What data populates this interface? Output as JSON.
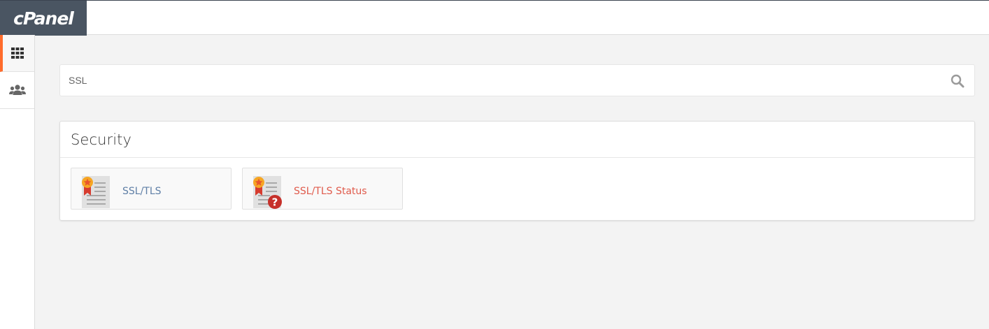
{
  "app": {
    "logo_text": "cPanel"
  },
  "sidebar": {
    "items": [
      {
        "name": "home-grid",
        "icon": "grid-icon",
        "active": true
      },
      {
        "name": "users",
        "icon": "users-icon",
        "active": false
      }
    ],
    "accent_color": "#ff6c2c"
  },
  "search": {
    "value": "SSL",
    "icon": "search-icon"
  },
  "panel": {
    "title": "Security",
    "tiles": [
      {
        "label": "SSL/TLS",
        "icon": "certificate-icon",
        "label_color": "#5f7fa6"
      },
      {
        "label": "SSL/TLS Status",
        "icon": "certificate-status-icon",
        "label_color": "#e05b4c"
      }
    ]
  }
}
